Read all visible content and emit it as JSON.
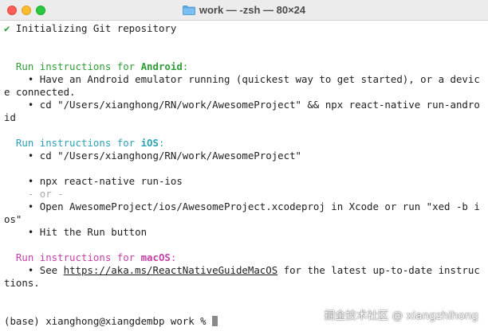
{
  "window": {
    "title": "work — -zsh — 80×24",
    "folder_icon": "folder-icon",
    "colors": {
      "close": "#ff5f57",
      "minimize": "#febc2e",
      "maximize": "#28c840",
      "green": "#2e9e37",
      "cyan": "#2aa3b3",
      "magenta": "#c53fa6"
    }
  },
  "terminal": {
    "init_check": "✔",
    "init_text": " Initializing Git repository",
    "android": {
      "heading": "Run instructions for ",
      "platform": "Android",
      "colon": ":",
      "bullet1_line1": "    • Have an Android emulator running (quickest way to get started), or a devic",
      "bullet1_line2": "e connected.",
      "bullet2_line1": "    • cd \"/Users/xianghong/RN/work/AwesomeProject\" && npx react-native run-andro",
      "bullet2_line2": "id"
    },
    "ios": {
      "heading": "Run instructions for ",
      "platform": "iOS",
      "colon": ":",
      "bullet1": "    • cd \"/Users/xianghong/RN/work/AwesomeProject\"",
      "bullet2": "    • npx react-native run-ios",
      "or": "    - or -",
      "bullet3_line1": "    • Open AwesomeProject/ios/AwesomeProject.xcodeproj in Xcode or run \"xed -b i",
      "bullet3_line2": "os\"",
      "bullet4": "    • Hit the Run button"
    },
    "macos": {
      "heading": "Run instructions for ",
      "platform": "macOS",
      "colon": ":",
      "see_prefix": "    • See ",
      "link": "https://aka.ms/ReactNativeGuideMacOS",
      "see_suffix": " for the latest up-to-date instruc",
      "line2": "tions."
    },
    "prompt": "(base) xianghong@xiangdembp work % "
  },
  "watermark": "掘金技术社区 @ xiangzhihong"
}
